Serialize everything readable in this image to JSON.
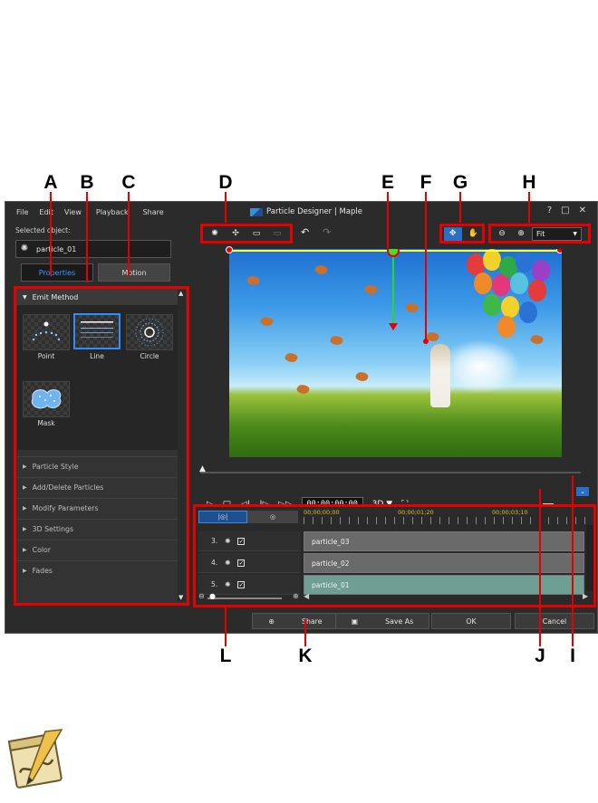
{
  "callouts": {
    "a": "A",
    "b": "B",
    "c": "C",
    "d": "D",
    "e": "E",
    "f": "F",
    "g": "G",
    "h": "H",
    "i": "I",
    "j": "J",
    "k": "K",
    "l": "L"
  },
  "menu": [
    "File",
    "Edit",
    "View",
    "Playback",
    "Share"
  ],
  "window": {
    "title": "Particle Designer | Maple",
    "help": "?",
    "maximize": "□",
    "close": "✕"
  },
  "left_panel": {
    "selected_label": "Selected object:",
    "selected_value": "particle_01",
    "tab_properties": "Properties",
    "tab_motion": "Motion",
    "emit_header": "Emit Method",
    "emit_options": [
      {
        "label": "Point"
      },
      {
        "label": "Line"
      },
      {
        "label": "Circle"
      },
      {
        "label": "Mask"
      }
    ],
    "sections": [
      "Particle Style",
      "Add/Delete Particles",
      "Modify Parameters",
      "3D Settings",
      "Color",
      "Fades"
    ]
  },
  "toolbar": {
    "zoom_fit": "Fit"
  },
  "playback": {
    "timecode": "00;00;00;00",
    "mode": "3D ▼"
  },
  "timeline": {
    "ruler": [
      "00;00;00;00",
      "00;00;01;20",
      "00;00;03;10"
    ],
    "tracks": [
      {
        "num": "3.",
        "clip": "particle_03"
      },
      {
        "num": "4.",
        "clip": "particle_02"
      },
      {
        "num": "5.",
        "clip": "particle_01"
      }
    ]
  },
  "footer": {
    "share": "Share",
    "save_as": "Save As",
    "ok": "OK",
    "cancel": "Cancel"
  },
  "colors": {
    "accent": "#e60000",
    "select_blue": "#2d8fff"
  }
}
